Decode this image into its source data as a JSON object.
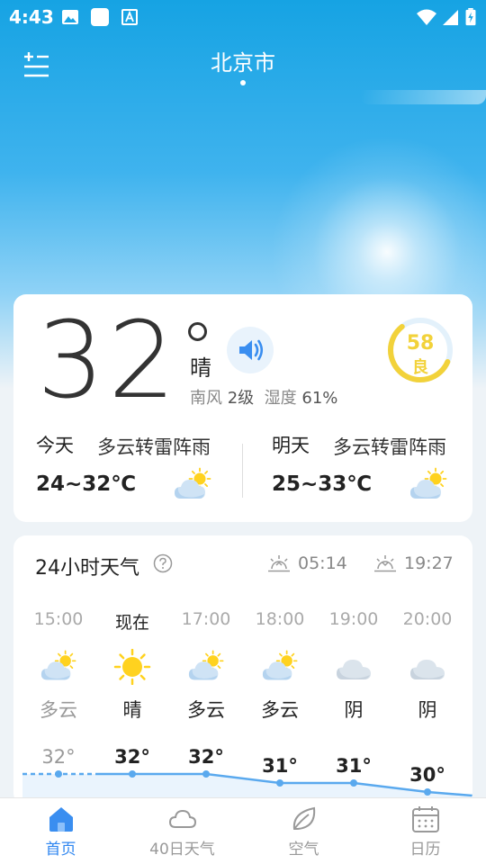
{
  "status_bar": {
    "time": "4:43"
  },
  "header": {
    "city": "北京市"
  },
  "current": {
    "temperature": "32",
    "condition": "晴",
    "wind_label": "南风",
    "wind_value": "2级",
    "humidity_label": "湿度",
    "humidity_value": "61%",
    "aqi_value": "58",
    "aqi_fraction": 0.58,
    "aqi_level": "良",
    "aqi_color": "#f2d23a"
  },
  "days": [
    {
      "name": "今天",
      "condition": "多云转雷阵雨",
      "range": "24~32℃",
      "icon": "partly-cloudy-icon"
    },
    {
      "name": "明天",
      "condition": "多云转雷阵雨",
      "range": "25~33℃",
      "icon": "partly-cloudy-icon"
    }
  ],
  "hourly": {
    "title": "24小时天气",
    "sunrise": "05:14",
    "sunset": "19:27",
    "hours": [
      {
        "time": "15:00",
        "icon": "partly-cloudy-icon",
        "condition": "多云",
        "temp": "32°",
        "temp_value": 32,
        "past": true
      },
      {
        "time": "现在",
        "icon": "sun-icon",
        "condition": "晴",
        "temp": "32°",
        "temp_value": 32,
        "now": true
      },
      {
        "time": "17:00",
        "icon": "partly-cloudy-icon",
        "condition": "多云",
        "temp": "32°",
        "temp_value": 32
      },
      {
        "time": "18:00",
        "icon": "partly-cloudy-icon",
        "condition": "多云",
        "temp": "31°",
        "temp_value": 31
      },
      {
        "time": "19:00",
        "icon": "cloud-icon",
        "condition": "阴",
        "temp": "31°",
        "temp_value": 31
      },
      {
        "time": "20:00",
        "icon": "cloud-icon",
        "condition": "阴",
        "temp": "30°",
        "temp_value": 30
      }
    ]
  },
  "nav": [
    {
      "label": "首页",
      "icon": "home-icon",
      "active": true
    },
    {
      "label": "40日天气",
      "icon": "cloud-outline-icon"
    },
    {
      "label": "空气",
      "icon": "leaf-icon"
    },
    {
      "label": "日历",
      "icon": "calendar-icon"
    }
  ],
  "colors": {
    "accent": "#2f86f0",
    "chart_line": "#5aa9ee",
    "sun": "#ffd21f",
    "cloud": "#d7e3ee"
  }
}
